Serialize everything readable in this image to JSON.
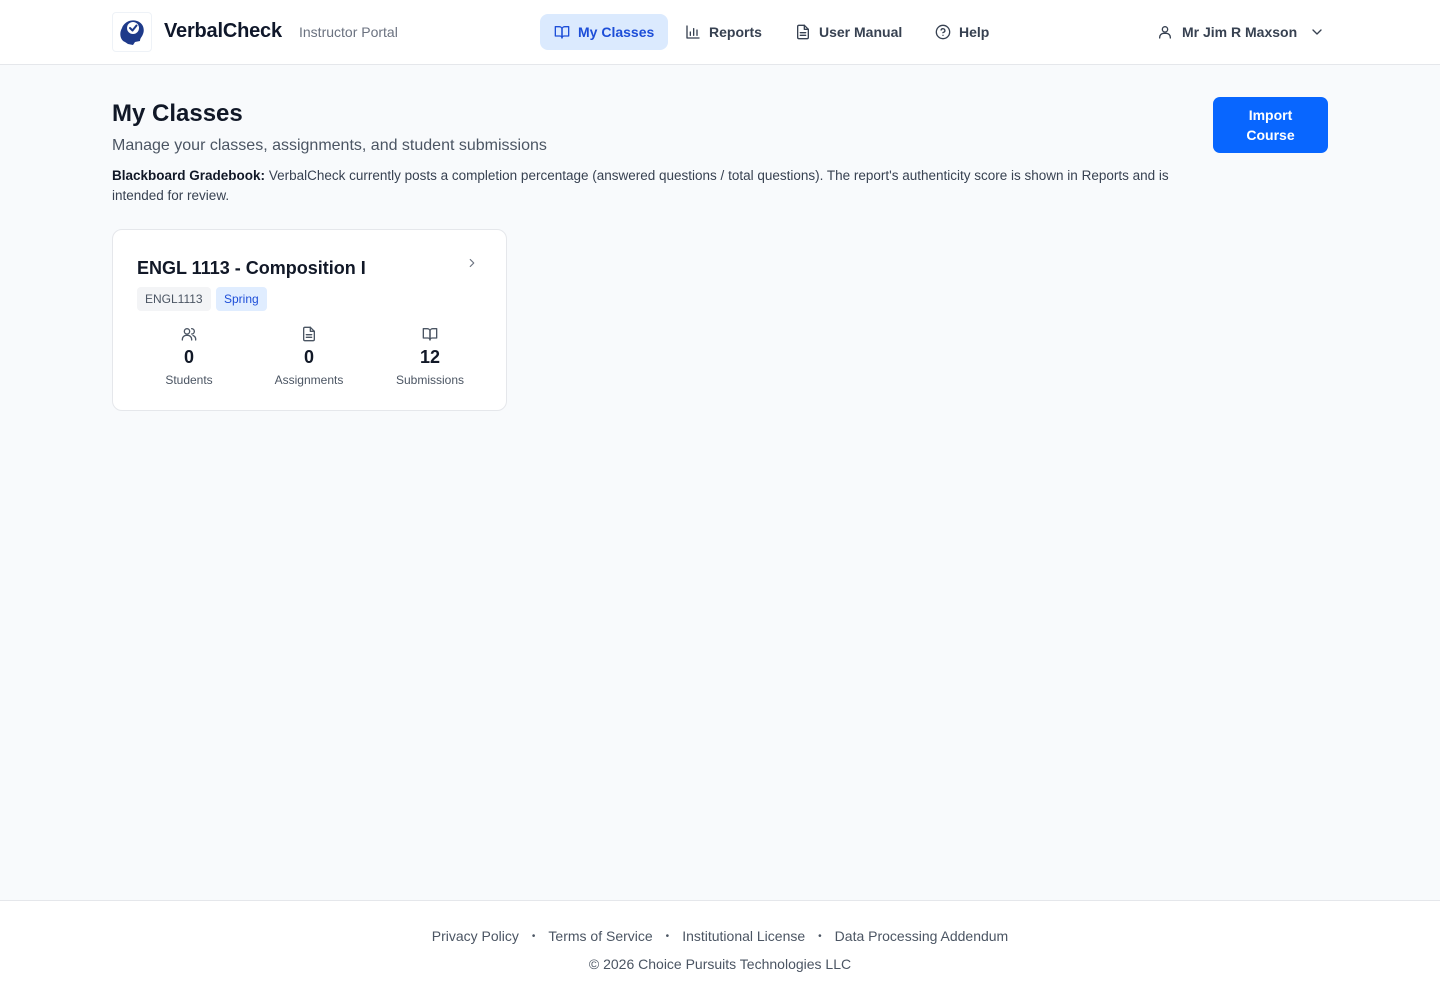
{
  "header": {
    "brand": "VerbalCheck",
    "portal_label": "Instructor Portal",
    "logo_text": "VerbalCheck",
    "nav": [
      {
        "label": "My Classes",
        "icon": "book-open-icon",
        "active": true
      },
      {
        "label": "Reports",
        "icon": "bar-chart-icon",
        "active": false
      },
      {
        "label": "User Manual",
        "icon": "document-icon",
        "active": false
      },
      {
        "label": "Help",
        "icon": "help-circle-icon",
        "active": false
      }
    ],
    "user": {
      "name": "Mr Jim R Maxson",
      "icon": "user-icon",
      "menu_icon": "chevron-down-icon"
    }
  },
  "page": {
    "title": "My Classes",
    "subtitle": "Manage your classes, assignments, and student submissions",
    "notice_label": "Blackboard Gradebook:",
    "notice_text": "VerbalCheck currently posts a completion percentage (answered questions / total questions). The report's authenticity score is shown in Reports and is intended for review.",
    "import_button": "Import Course"
  },
  "classes": [
    {
      "title": "ENGL 1113 - Composition I",
      "code": "ENGL1113",
      "term": "Spring",
      "stats": [
        {
          "value": "0",
          "label": "Students",
          "icon": "users-icon"
        },
        {
          "value": "0",
          "label": "Assignments",
          "icon": "file-text-icon"
        },
        {
          "value": "12",
          "label": "Submissions",
          "icon": "book-open-icon"
        }
      ]
    }
  ],
  "footer": {
    "links": [
      "Privacy Policy",
      "Terms of Service",
      "Institutional License",
      "Data Processing Addendum"
    ],
    "separator": "•",
    "copyright": "© 2026 Choice Pursuits Technologies LLC"
  },
  "colors": {
    "accent": "#0866ff",
    "nav_active_bg": "#dbeafe",
    "nav_active_text": "#1d4ed8",
    "background": "#f8fafc"
  }
}
